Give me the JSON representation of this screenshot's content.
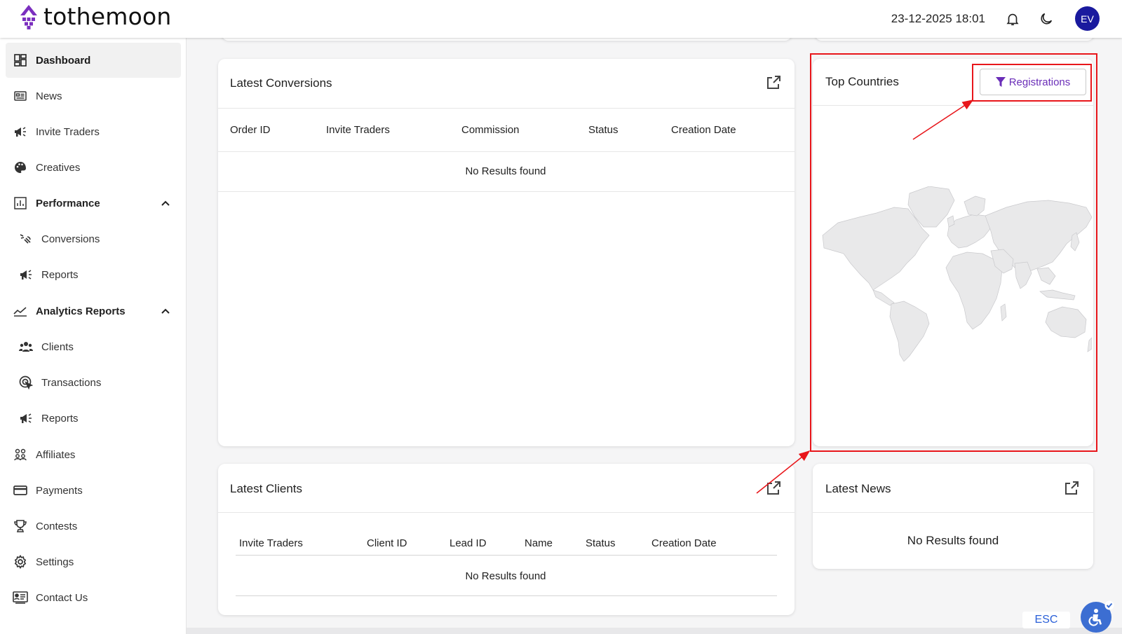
{
  "header": {
    "logo_text": "tothemoon",
    "datetime": "23-12-2025 18:01",
    "avatar_initials": "EV"
  },
  "sidebar": {
    "items": [
      {
        "label": "Dashboard",
        "icon": "dashboard-icon"
      },
      {
        "label": "News",
        "icon": "news-icon"
      },
      {
        "label": "Invite Traders",
        "icon": "megaphone-icon"
      },
      {
        "label": "Creatives",
        "icon": "palette-icon"
      },
      {
        "label": "Performance",
        "icon": "bar-chart-icon"
      },
      {
        "label": "Conversions",
        "icon": "conversions-icon"
      },
      {
        "label": "Reports",
        "icon": "megaphone-icon"
      },
      {
        "label": "Analytics Reports",
        "icon": "line-chart-icon"
      },
      {
        "label": "Clients",
        "icon": "clients-icon"
      },
      {
        "label": "Transactions",
        "icon": "transactions-icon"
      },
      {
        "label": "Reports",
        "icon": "megaphone-icon"
      },
      {
        "label": "Affiliates",
        "icon": "affiliates-icon"
      },
      {
        "label": "Payments",
        "icon": "card-icon"
      },
      {
        "label": "Contests",
        "icon": "trophy-icon"
      },
      {
        "label": "Settings",
        "icon": "gear-icon"
      },
      {
        "label": "Contact Us",
        "icon": "contact-icon"
      }
    ]
  },
  "latest_conversions": {
    "title": "Latest Conversions",
    "columns": [
      "Order ID",
      "Invite Traders",
      "Commission",
      "Status",
      "Creation Date"
    ],
    "empty_text": "No Results found"
  },
  "top_countries": {
    "title": "Top Countries",
    "filter_label": "Registrations"
  },
  "latest_clients": {
    "title": "Latest Clients",
    "columns": [
      "Invite Traders",
      "Client ID",
      "Lead ID",
      "Name",
      "Status",
      "Creation Date"
    ],
    "empty_text": "No Results found"
  },
  "latest_news": {
    "title": "Latest News",
    "empty_text": "No Results found"
  },
  "footer": {
    "esc_label": "ESC"
  },
  "colors": {
    "accent": "#6a2db8",
    "avatar_bg": "#1a1a9e",
    "annotation": "#e8161b",
    "a11y_button": "#3c6ed2"
  }
}
